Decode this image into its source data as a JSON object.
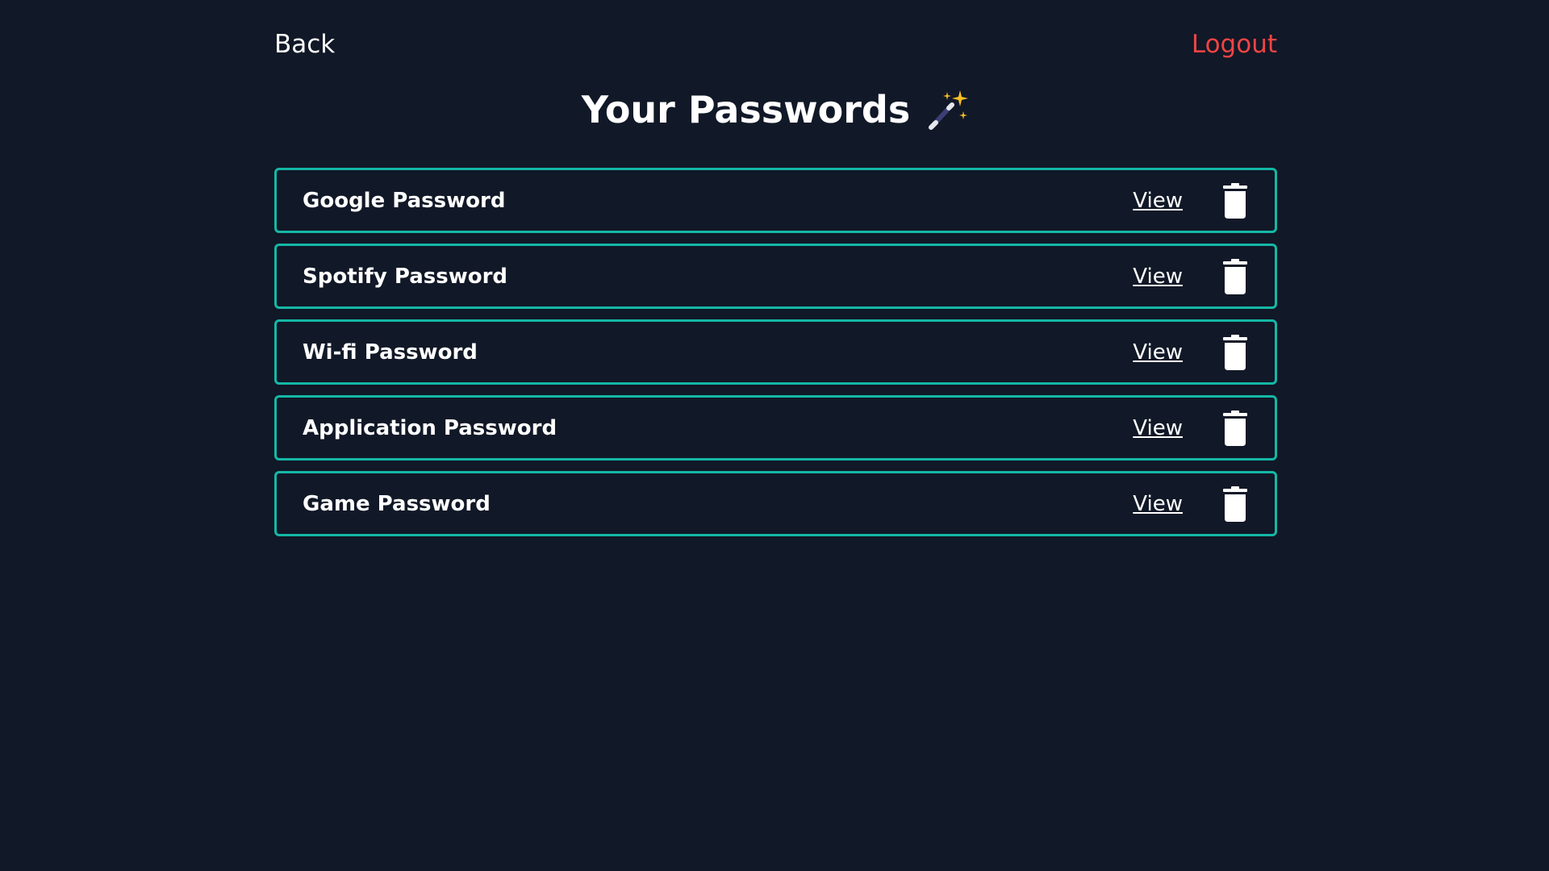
{
  "nav": {
    "back_label": "Back",
    "logout_label": "Logout"
  },
  "page": {
    "title": "Your Passwords",
    "title_icon": "magic-wand-icon"
  },
  "passwords": [
    {
      "label": "Google Password",
      "view_label": "View",
      "delete_icon": "trash-icon"
    },
    {
      "label": "Spotify Password",
      "view_label": "View",
      "delete_icon": "trash-icon"
    },
    {
      "label": "Wi-fi Password",
      "view_label": "View",
      "delete_icon": "trash-icon"
    },
    {
      "label": "Application Password",
      "view_label": "View",
      "delete_icon": "trash-icon"
    },
    {
      "label": "Game Password",
      "view_label": "View",
      "delete_icon": "trash-icon"
    }
  ],
  "colors": {
    "background": "#111827",
    "accent_border": "#14b8a6",
    "logout": "#ef4444",
    "text": "#ffffff"
  }
}
